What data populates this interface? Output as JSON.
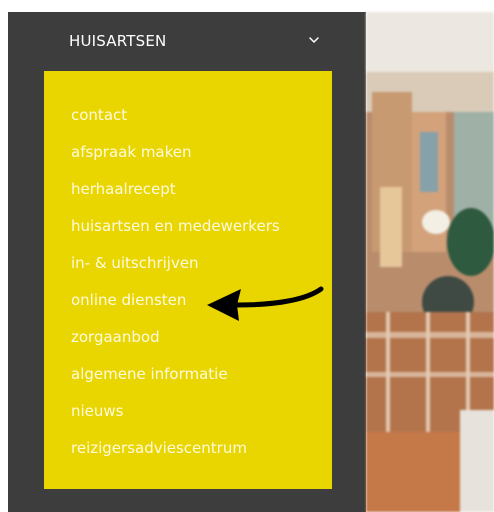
{
  "header": {
    "title": "HUISARTSEN",
    "chevron_icon": "chevron-down-icon"
  },
  "menu": {
    "background": "#e9d500",
    "items": [
      {
        "label": "contact"
      },
      {
        "label": "afspraak maken"
      },
      {
        "label": "herhaalrecept"
      },
      {
        "label": "huisartsen en medewerkers"
      },
      {
        "label": "in- & uitschrijven"
      },
      {
        "label": "online diensten"
      },
      {
        "label": "zorgaanbod"
      },
      {
        "label": "algemene informatie"
      },
      {
        "label": "nieuws"
      },
      {
        "label": "reizigersadviescentrum"
      }
    ]
  },
  "annotation": {
    "icon": "arrow-left-icon",
    "points_to": "online diensten"
  },
  "colors": {
    "panel": "#3d3d3d",
    "menu": "#e9d500",
    "text": "#ffffff"
  }
}
